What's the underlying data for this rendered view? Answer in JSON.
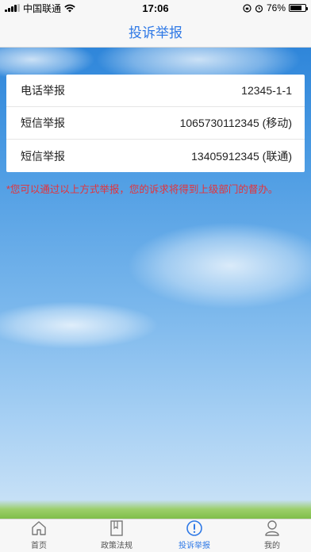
{
  "statusbar": {
    "carrier": "中国联通",
    "time": "17:06",
    "battery": "76%",
    "battery_level": 0.76
  },
  "navbar": {
    "title": "投诉举报"
  },
  "reports": [
    {
      "label": "电话举报",
      "value": "12345-1-1"
    },
    {
      "label": "短信举报",
      "value": "1065730112345 (移动)"
    },
    {
      "label": "短信举报",
      "value": "13405912345 (联通)"
    }
  ],
  "notice": "*您可以通过以上方式举报，您的诉求将得到上级部门的督办。",
  "tabs": [
    {
      "label": "首页",
      "icon": "home-icon"
    },
    {
      "label": "政策法规",
      "icon": "book-icon"
    },
    {
      "label": "投诉举报",
      "icon": "alert-icon"
    },
    {
      "label": "我的",
      "icon": "user-icon"
    }
  ],
  "colors": {
    "accent": "#2f79e6",
    "notice": "#e5323a",
    "sky": "#4d9ce3"
  }
}
